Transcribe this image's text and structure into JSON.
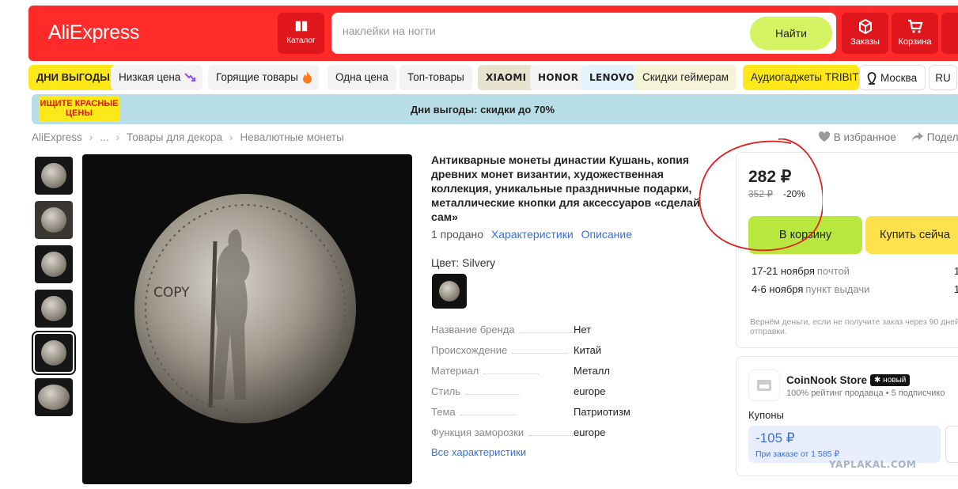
{
  "header": {
    "logo": "AliExpress",
    "catalog_label": "Каталог",
    "search_placeholder": "наклейки на ногти",
    "search_button": "Найти",
    "orders_label": "Заказы",
    "cart_label": "Корзина"
  },
  "chips": [
    {
      "label": "ДНИ ВЫГОДЫ",
      "style": "yellow"
    },
    {
      "label": "Низкая цена",
      "icon": "arrow-down-icon"
    },
    {
      "label": "Горящие товары",
      "icon": "fire-icon"
    },
    {
      "label": "Одна цена"
    },
    {
      "label": "Топ-товары"
    },
    {
      "label": "XIAOMI",
      "style": "brand"
    },
    {
      "label": "HONOR",
      "style": "brand"
    },
    {
      "label": "LENOVO",
      "style": "brand"
    },
    {
      "label": "Скидки геймерам"
    },
    {
      "label": "Аудиогаджеты TRIBIT",
      "style": "yellow-regular"
    }
  ],
  "location": {
    "label": "Москва",
    "language": "RU"
  },
  "banner": {
    "badge": "ИЩИТЕ КРАСНЫЕ ЦЕНЫ",
    "text": "Дни выгоды: скидки до 70%"
  },
  "breadcrumbs": [
    "AliExpress",
    "...",
    "Товары для декора",
    "Невалютные монеты"
  ],
  "actions": {
    "favorite": "В избранное",
    "share": "Подел"
  },
  "product": {
    "title": "Антикварные монеты династии Кушань, копия древних монет византии, художественная коллекция, уникальные праздничные подарки, металлические кнопки для аксессуаров «сделай сам»",
    "sold": "1 продано",
    "characteristics_link": "Характеристики",
    "description_link": "Описание",
    "color_label": "Цвет: Silvery",
    "image_overlay_text": "COPY",
    "thumbnail_count": 6,
    "active_thumbnail": 5,
    "specs": [
      {
        "key": "Название бренда",
        "value": "Нет"
      },
      {
        "key": "Происхождение",
        "value": "Китай"
      },
      {
        "key": "Материал",
        "value": "Металл"
      },
      {
        "key": "Стиль",
        "value": "europe"
      },
      {
        "key": "Тема",
        "value": "Патриотизм"
      },
      {
        "key": "Функция заморозки",
        "value": "europe"
      }
    ],
    "all_specs_link": "Все характеристики"
  },
  "price": {
    "current": "282 ₽",
    "old": "352 ₽",
    "discount": "-20%",
    "cart_button": "В корзину",
    "buy_button": "Купить сейча",
    "delivery": [
      {
        "dates": "17-21 ноября",
        "method": "почтой",
        "right": "1"
      },
      {
        "dates": "4-6 ноября",
        "method": "пункт выдачи",
        "right": "1("
      }
    ],
    "refund_note": "Вернём деньги, если не получите заказ через 90 дней после отправки."
  },
  "store": {
    "name": "CoinNook Store",
    "badge": "новый",
    "meta": "100% рейтинг продавца • 5 подписчико",
    "coupons_label": "Купоны",
    "coupon_amount": "-105 ₽",
    "coupon_condition": "При заказе от 1 585 ₽"
  },
  "watermark": "YAPLAKAL.COM",
  "colors": {
    "brand_red": "#ff2a2a",
    "accent_green": "#d4f262",
    "cart_green": "#b8e840",
    "buy_yellow": "#ffe04d",
    "link_blue": "#3b6fd4",
    "annotation_red": "#e02020"
  }
}
